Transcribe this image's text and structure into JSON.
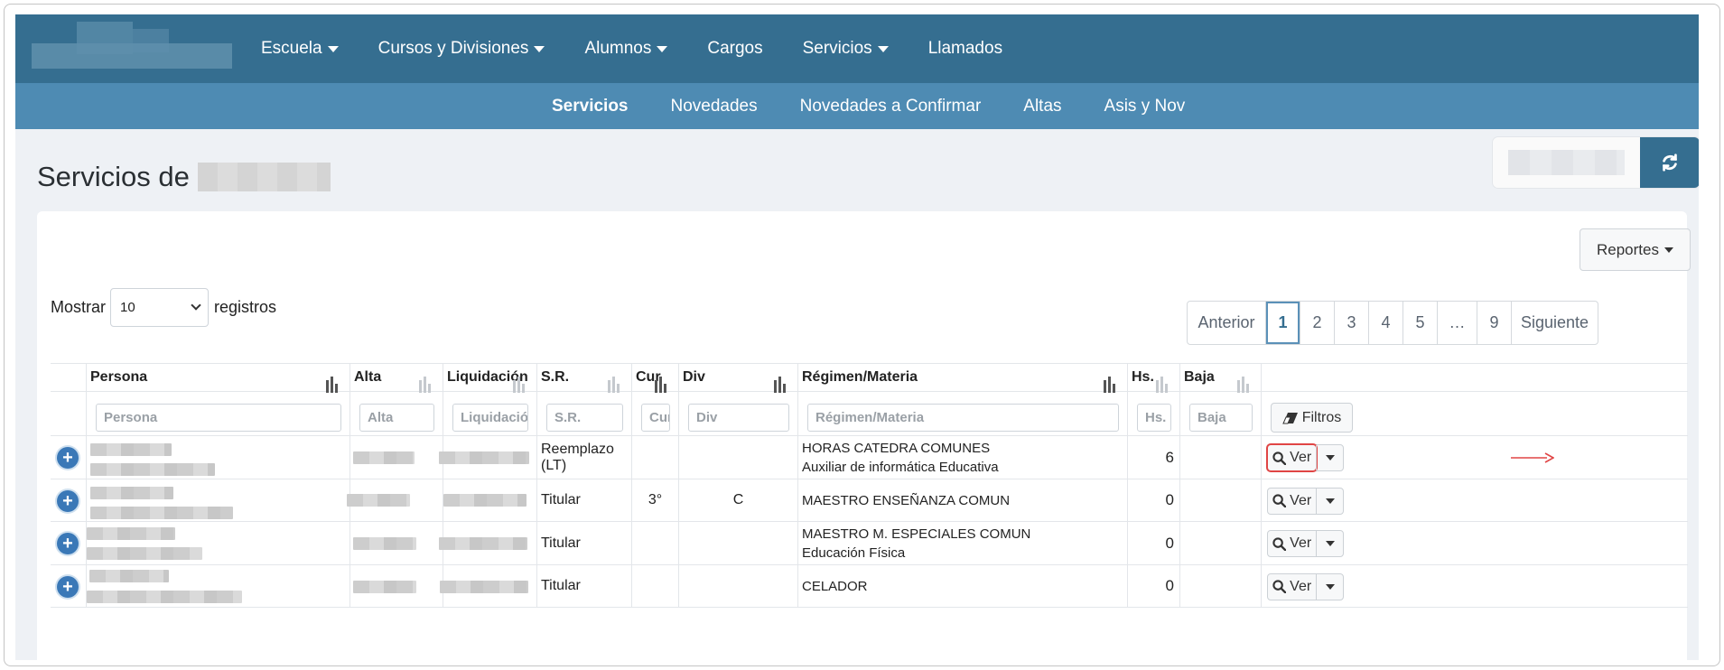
{
  "topnav": [
    {
      "label": "Escuela",
      "dropdown": true
    },
    {
      "label": "Cursos y Divisiones",
      "dropdown": true
    },
    {
      "label": "Alumnos",
      "dropdown": true
    },
    {
      "label": "Cargos",
      "dropdown": false
    },
    {
      "label": "Servicios",
      "dropdown": true
    },
    {
      "label": "Llamados",
      "dropdown": false
    }
  ],
  "subnav": [
    {
      "label": "Servicios",
      "active": true
    },
    {
      "label": "Novedades",
      "active": false
    },
    {
      "label": "Novedades a Confirmar",
      "active": false
    },
    {
      "label": "Altas",
      "active": false
    },
    {
      "label": "Asis y Nov",
      "active": false
    }
  ],
  "page": {
    "title": "Servicios de"
  },
  "reportes": {
    "label": "Reportes"
  },
  "length": {
    "prefix": "Mostrar",
    "value": "10",
    "suffix": "registros"
  },
  "pagination": {
    "prev": "Anterior",
    "pages": [
      "1",
      "2",
      "3",
      "4",
      "5",
      "…",
      "9"
    ],
    "active": "1",
    "next": "Siguiente"
  },
  "table": {
    "headers": [
      "Persona",
      "Alta",
      "Liquidación",
      "S.R.",
      "Cur",
      "Div",
      "Régimen/Materia",
      "Hs.",
      "Baja"
    ],
    "filters": [
      "Persona",
      "Alta",
      "Liquidación",
      "S.R.",
      "Cur",
      "Div",
      "Régimen/Materia",
      "Hs.",
      "Baja"
    ],
    "filtros_label": "Filtros",
    "ver_label": "Ver",
    "rows": [
      {
        "sr": "Reemplazo (LT)",
        "cur": "",
        "div": "",
        "regimen": "HORAS CATEDRA COMUNES",
        "materia": "Auxiliar de informática Educativa",
        "hs": "6",
        "baja": ""
      },
      {
        "sr": "Titular",
        "cur": "3°",
        "div": "C",
        "regimen": "MAESTRO ENSEÑANZA COMUN",
        "materia": "",
        "hs": "0",
        "baja": ""
      },
      {
        "sr": "Titular",
        "cur": "",
        "div": "",
        "regimen": "MAESTRO M. ESPECIALES COMUN",
        "materia": "Educación Física",
        "hs": "0",
        "baja": ""
      },
      {
        "sr": "Titular",
        "cur": "",
        "div": "",
        "regimen": "CELADOR",
        "materia": "",
        "hs": "0",
        "baja": ""
      }
    ]
  },
  "colors": {
    "navbar": "#356e90",
    "subnav": "#4e8bb3",
    "highlight": "#e04545"
  }
}
